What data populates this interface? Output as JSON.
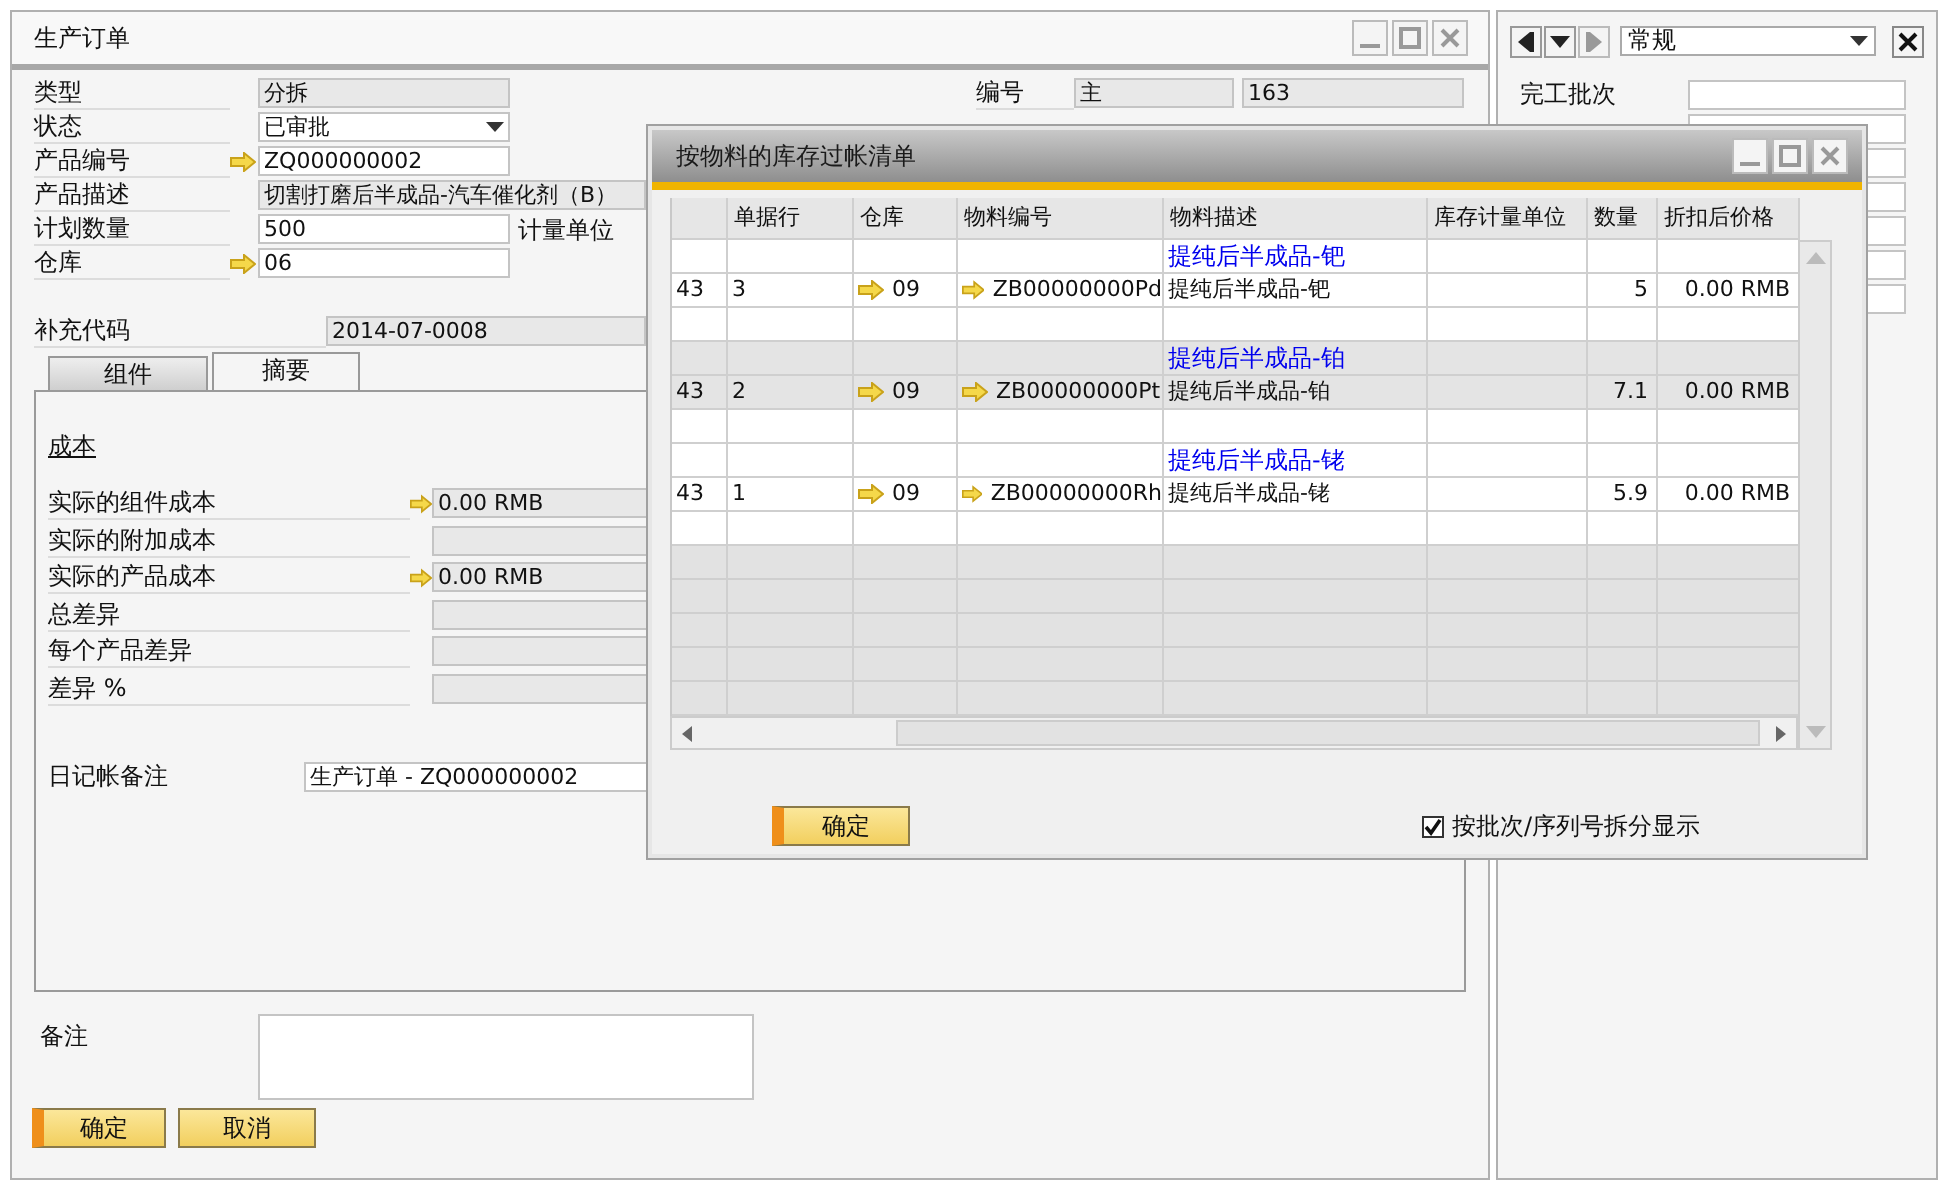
{
  "main_window": {
    "title": "生产订单"
  },
  "header_fields": [
    {
      "label": "类型",
      "value": "分拆",
      "kind": "readonly"
    },
    {
      "label": "状态",
      "value": "已审批",
      "kind": "dropdown"
    },
    {
      "label": "产品编号",
      "value": "ZQ000000002",
      "kind": "link"
    },
    {
      "label": "产品描述",
      "value": "切割打磨后半成品-汽车催化剂（B）",
      "kind": "readonly_wide"
    },
    {
      "label": "计划数量",
      "value": "500",
      "kind": "input",
      "extra_label": "计量单位"
    },
    {
      "label": "仓库",
      "value": "06",
      "kind": "link"
    }
  ],
  "number": {
    "label": "编号",
    "series": "主",
    "value": "163"
  },
  "supplement_code": {
    "label": "补充代码",
    "value": "2014-07-0008"
  },
  "tabs": [
    {
      "label": "组件",
      "selected": false
    },
    {
      "label": "摘要",
      "selected": true
    }
  ],
  "summary": {
    "section_title": "成本",
    "cost_rows": [
      {
        "label": "实际的组件成本",
        "value": "0.00 RMB",
        "link": true
      },
      {
        "label": "实际的附加成本",
        "link": false
      },
      {
        "label": "实际的产品成本",
        "value": "0.00 RMB",
        "link": true
      },
      {
        "label": "总差异",
        "link": false
      },
      {
        "label": "每个产品差异",
        "link": false
      },
      {
        "label": "差异 %",
        "link": false
      }
    ],
    "journal_remark": {
      "label": "日记帐备注",
      "value": "生产订单 - ZQ000000002"
    }
  },
  "remarks": {
    "label": "备注"
  },
  "buttons": [
    {
      "label": "确定",
      "kind": "primary"
    },
    {
      "label": "取消",
      "kind": "secondary"
    }
  ],
  "side_panel": {
    "view": "常规",
    "fields": [
      {
        "label": "完工批次"
      }
    ]
  },
  "dialog": {
    "title": "按物料的库存过帐清单",
    "columns": [
      {
        "label": "单据行"
      },
      {
        "label": "仓库"
      },
      {
        "label": "物料编号"
      },
      {
        "label": "物料描述"
      },
      {
        "label": "库存计量单位"
      },
      {
        "label": "数量"
      },
      {
        "label": "折扣后价格"
      }
    ],
    "groups": [
      {
        "heading": "提纯后半成品-钯",
        "selected": false,
        "cells": [
          "43",
          "3",
          "09",
          "ZB00000000Pd",
          "提纯后半成品-钯",
          null,
          "5",
          "0.00 RMB"
        ]
      },
      {
        "heading": "提纯后半成品-铂",
        "selected": true,
        "cells": [
          "43",
          "2",
          "09",
          "ZB00000000Pt",
          "提纯后半成品-铂",
          null,
          "7.1",
          "0.00 RMB"
        ]
      },
      {
        "heading": "提纯后半成品-铑",
        "selected": false,
        "cells": [
          "43",
          "1",
          "09",
          "ZB00000000Rh",
          "提纯后半成品-铑",
          null,
          "5.9",
          "0.00 RMB"
        ]
      }
    ],
    "ok_button": "确定",
    "split_checkbox": {
      "label": "按批次/序列号拆分显示",
      "checked": true
    }
  }
}
